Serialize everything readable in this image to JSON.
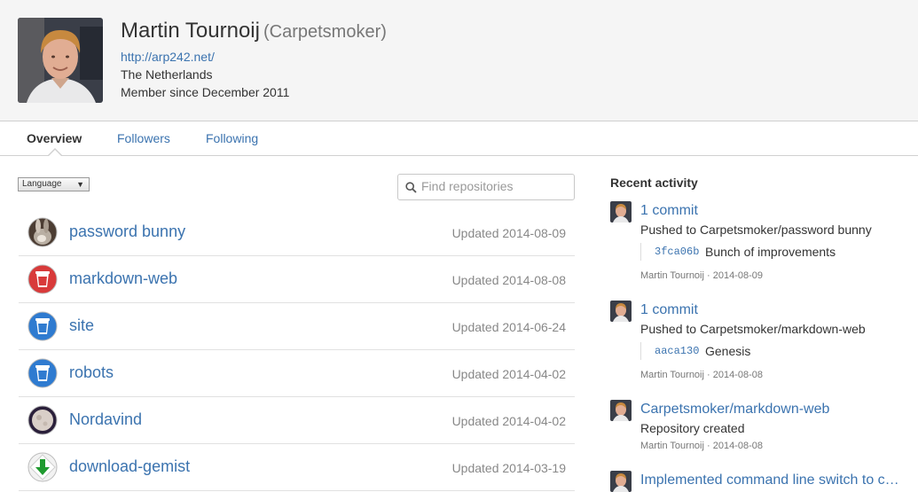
{
  "profile": {
    "name": "Martin Tournoij",
    "username": "(Carpetsmoker)",
    "website": "http://arp242.net/",
    "location": "The Netherlands",
    "member_since": "Member since December 2011"
  },
  "tabs": [
    "Overview",
    "Followers",
    "Following"
  ],
  "filter": {
    "language_label": "Language",
    "search_placeholder": "Find repositories"
  },
  "repos": [
    {
      "name": "password bunny",
      "updated": "Updated 2014-08-09",
      "icon": "bunny-photo-icon"
    },
    {
      "name": "markdown-web",
      "updated": "Updated 2014-08-08",
      "icon": "red-cup-icon"
    },
    {
      "name": "site",
      "updated": "Updated 2014-06-24",
      "icon": "blue-cup-icon"
    },
    {
      "name": "robots",
      "updated": "Updated 2014-04-02",
      "icon": "blue-cup-icon"
    },
    {
      "name": "Nordavind",
      "updated": "Updated 2014-04-02",
      "icon": "moon-icon"
    },
    {
      "name": "download-gemist",
      "updated": "Updated 2014-03-19",
      "icon": "download-arrow-icon"
    }
  ],
  "activity": {
    "title": "Recent activity",
    "items": [
      {
        "link": "1 commit",
        "text": "Pushed to Carpetsmoker/password bunny",
        "sha": "3fca06b",
        "message": "Bunch of improvements",
        "meta": "Martin Tournoij · 2014-08-09"
      },
      {
        "link": "1 commit",
        "text": "Pushed to Carpetsmoker/markdown-web",
        "sha": "aaca130",
        "message": "Genesis",
        "meta": "Martin Tournoij · 2014-08-08"
      },
      {
        "link": "Carpetsmoker/markdown-web",
        "text": "Repository created",
        "meta": "Martin Tournoij · 2014-08-08"
      },
      {
        "link": "Implemented command line switch to c…"
      }
    ]
  }
}
